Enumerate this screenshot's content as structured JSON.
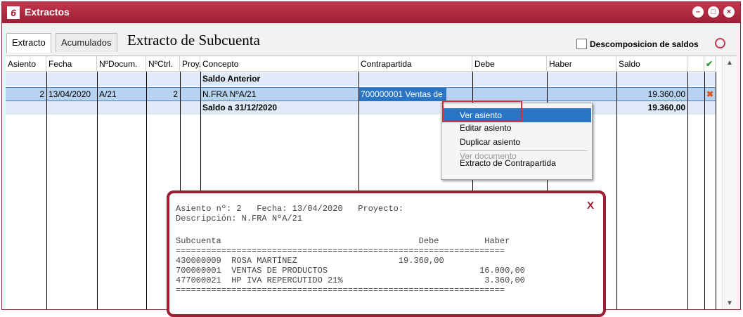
{
  "window": {
    "title": "Extractos",
    "icon": "app-logo-icon"
  },
  "toolbar": {
    "tabs": [
      {
        "label": "Extracto"
      },
      {
        "label": "Acumulados"
      }
    ],
    "title": "Extracto de Subcuenta",
    "checkbox_label": "Descomposicion de saldos"
  },
  "table": {
    "headers": [
      "Asiento",
      "Fecha",
      "NºDocum.",
      "NºCtrl.",
      "Proy.",
      "Concepto",
      "Contrapartida",
      "Debe",
      "Haber",
      "Saldo"
    ],
    "rows": [
      {
        "asiento": "",
        "fecha": "",
        "documento": "",
        "control": "",
        "concepto": "Saldo Anterior",
        "contrapartida": "",
        "saldo": ""
      },
      {
        "asiento": "2",
        "fecha": "13/04/2020",
        "documento": "A/21",
        "control": "2",
        "concepto": "N.FRA NºA/21",
        "contrapartida": "700000001 Ventas de",
        "saldo": "19.360,00"
      },
      {
        "asiento": "",
        "fecha": "",
        "documento": "",
        "control": "",
        "concepto": "Saldo a 31/12/2020",
        "contrapartida": "",
        "saldo": "19.360,00"
      }
    ]
  },
  "context_menu": {
    "items": [
      {
        "label": "Ver asiento"
      },
      {
        "label": "Editar asiento"
      },
      {
        "label": "Duplicar asiento"
      },
      {
        "label": "Ver documento"
      },
      {
        "label": "Extracto de Contrapartida"
      }
    ]
  },
  "popup": {
    "line1": "Asiento nº: 2   Fecha: 13/04/2020   Proyecto:",
    "line2": "Descripción: N.FRA NºA/21",
    "close": "X",
    "header": "Subcuenta                                       Debe         Haber",
    "separator": "=================================================================",
    "entries": [
      "430000009  ROSA MARTÍNEZ                    19.360,00",
      "700000001  VENTAS DE PRODUCTOS                              16.000,00",
      "477000021  HP IVA REPERCUTIDO 21%                            3.360,00"
    ]
  },
  "colors": {
    "brand": "#9c1f33",
    "selection": "#b7d3ef",
    "menu_highlight": "#2a75c4"
  }
}
